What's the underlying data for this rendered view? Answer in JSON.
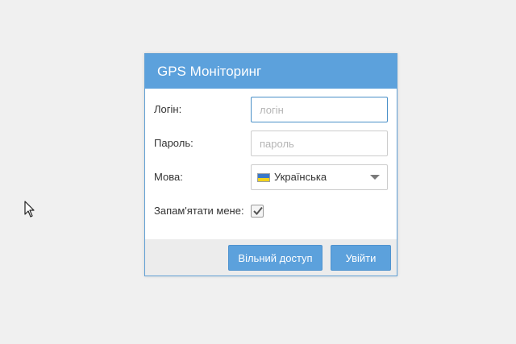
{
  "dialog": {
    "title": "GPS Моніторинг"
  },
  "form": {
    "login": {
      "label": "Логін:",
      "value": "",
      "placeholder": "логін"
    },
    "password": {
      "label": "Пароль:",
      "value": "",
      "placeholder": "пароль"
    },
    "language": {
      "label": "Мова:",
      "selected": "Українська",
      "flag_icon": "ukraine-flag-icon"
    },
    "remember": {
      "label": "Запам'ятати мене:",
      "checked": true
    }
  },
  "footer": {
    "free_access_label": "Вільний доступ",
    "login_label": "Увійти"
  },
  "colors": {
    "accent": "#5ca1dc",
    "background": "#f0f0f0",
    "footer": "#ececec"
  }
}
